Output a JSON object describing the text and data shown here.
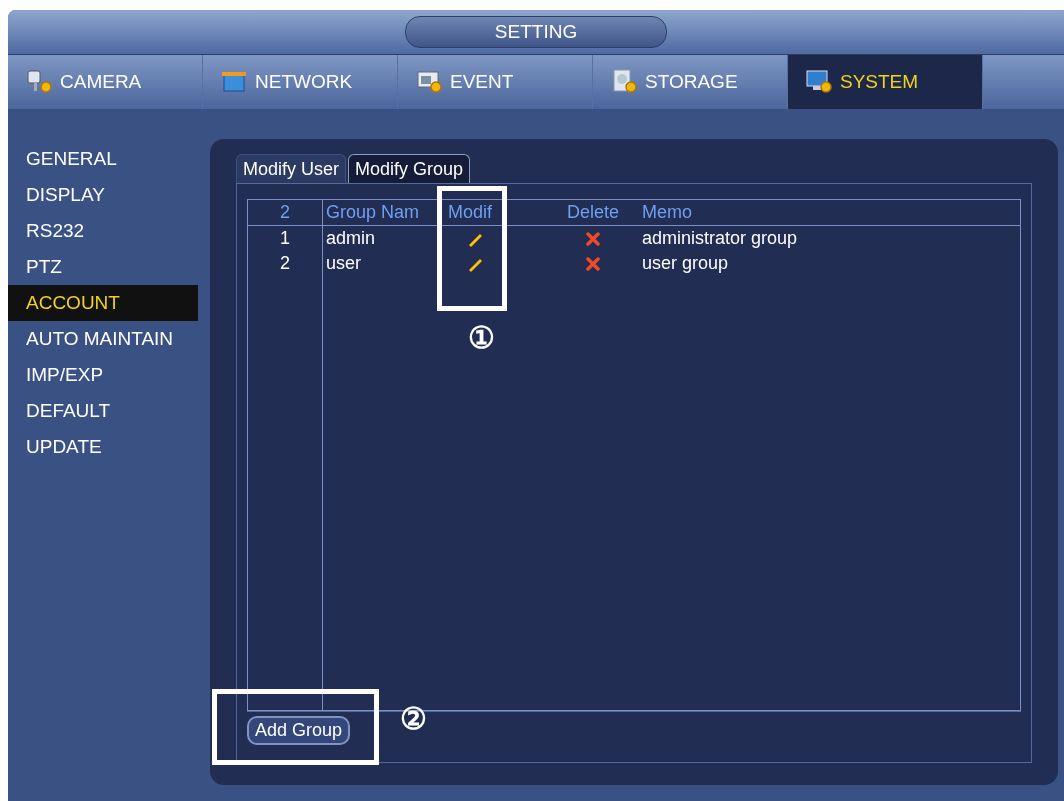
{
  "window": {
    "title": "SETTING"
  },
  "tabs": [
    {
      "label": "CAMERA",
      "selected": false
    },
    {
      "label": "NETWORK",
      "selected": false
    },
    {
      "label": "EVENT",
      "selected": false
    },
    {
      "label": "STORAGE",
      "selected": false
    },
    {
      "label": "SYSTEM",
      "selected": true
    }
  ],
  "sidebar": {
    "items": [
      {
        "label": "GENERAL",
        "selected": false
      },
      {
        "label": "DISPLAY",
        "selected": false
      },
      {
        "label": "RS232",
        "selected": false
      },
      {
        "label": "PTZ",
        "selected": false
      },
      {
        "label": "ACCOUNT",
        "selected": true
      },
      {
        "label": "AUTO MAINTAIN",
        "selected": false
      },
      {
        "label": "IMP/EXP",
        "selected": false
      },
      {
        "label": "DEFAULT",
        "selected": false
      },
      {
        "label": "UPDATE",
        "selected": false
      }
    ]
  },
  "subtabs": [
    {
      "label": "Modify User",
      "selected": false
    },
    {
      "label": "Modify Group",
      "selected": true
    }
  ],
  "table": {
    "columns": [
      "2",
      "Group Nam",
      "Modif",
      "Delete",
      "Memo"
    ],
    "rows": [
      {
        "index": "1",
        "name": "admin",
        "memo": "administrator group"
      },
      {
        "index": "2",
        "name": "user",
        "memo": "user group"
      }
    ]
  },
  "buttons": [
    "Add Group"
  ],
  "callouts": [
    "①",
    "②"
  ]
}
